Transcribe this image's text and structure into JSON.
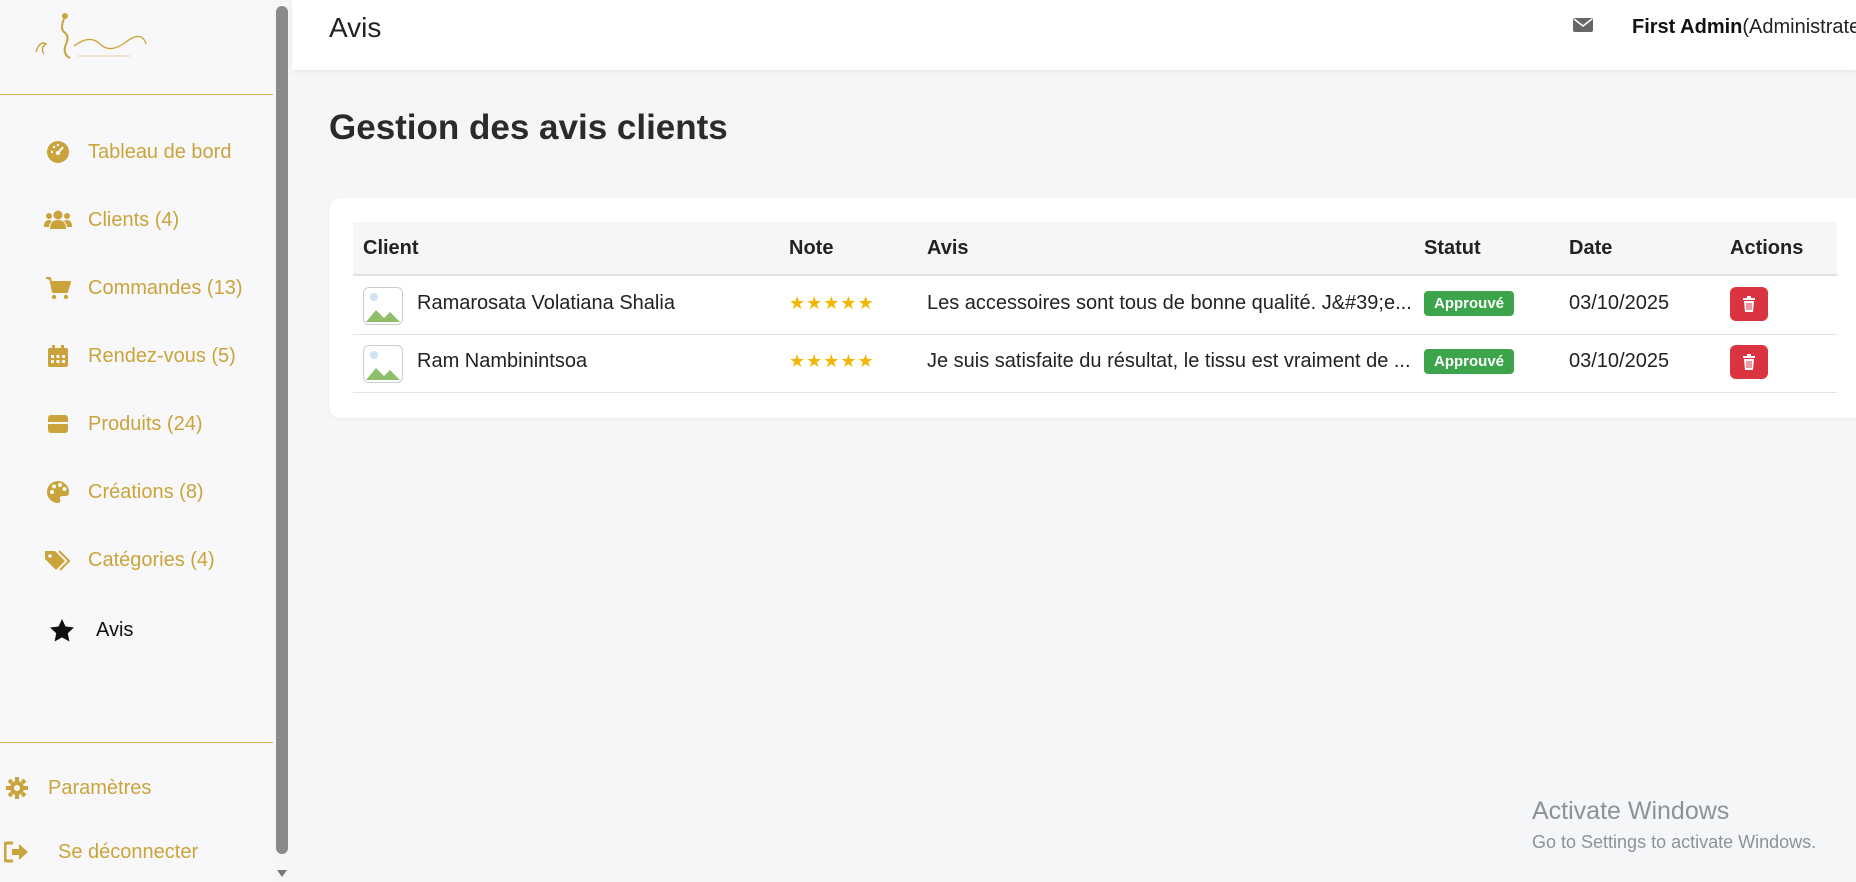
{
  "app": {
    "title": "Avis",
    "logo_alt": "E. Akanjaika"
  },
  "header": {
    "user_name": "First Admin",
    "user_role": "(Administrateur",
    "mail_icon": "envelope-icon"
  },
  "sidebar": {
    "items": [
      {
        "label": "Tableau de bord",
        "icon": "dashboard-icon"
      },
      {
        "label": "Clients (4)",
        "icon": "users-icon"
      },
      {
        "label": "Commandes (13)",
        "icon": "cart-icon"
      },
      {
        "label": "Rendez-vous (5)",
        "icon": "calendar-icon"
      },
      {
        "label": "Produits (24)",
        "icon": "box-icon"
      },
      {
        "label": "Créations (8)",
        "icon": "palette-icon"
      },
      {
        "label": "Catégories (4)",
        "icon": "tags-icon"
      },
      {
        "label": "Avis",
        "icon": "star-icon",
        "active": true
      }
    ],
    "bottom": [
      {
        "label": "Paramètres",
        "icon": "gear-icon"
      },
      {
        "label": "Se déconnecter",
        "icon": "logout-icon"
      }
    ]
  },
  "main": {
    "title": "Gestion des avis clients",
    "table": {
      "headers": [
        "Client",
        "Note",
        "Avis",
        "Statut",
        "Date",
        "Actions"
      ],
      "rows": [
        {
          "client": "Ramarosata Volatiana Shalia",
          "rating": 5,
          "stars": "★★★★★",
          "review": "Les accessoires sont tous de bonne qualité. J&#39;e...",
          "status": "Approuvé",
          "date": "03/10/2025"
        },
        {
          "client": "Ram Nambinintsoa",
          "rating": 5,
          "stars": "★★★★★",
          "review": "Je suis satisfaite du résultat, le tissu est vraiment de ...",
          "status": "Approuvé",
          "date": "03/10/2025"
        }
      ]
    }
  },
  "watermark": {
    "line1": "Activate Windows",
    "line2": "Go to Settings to activate Windows."
  },
  "colors": {
    "accent": "#caa43a",
    "badge_green": "#3ca44a",
    "delete_red": "#d9343f",
    "star_yellow": "#f2b705"
  }
}
